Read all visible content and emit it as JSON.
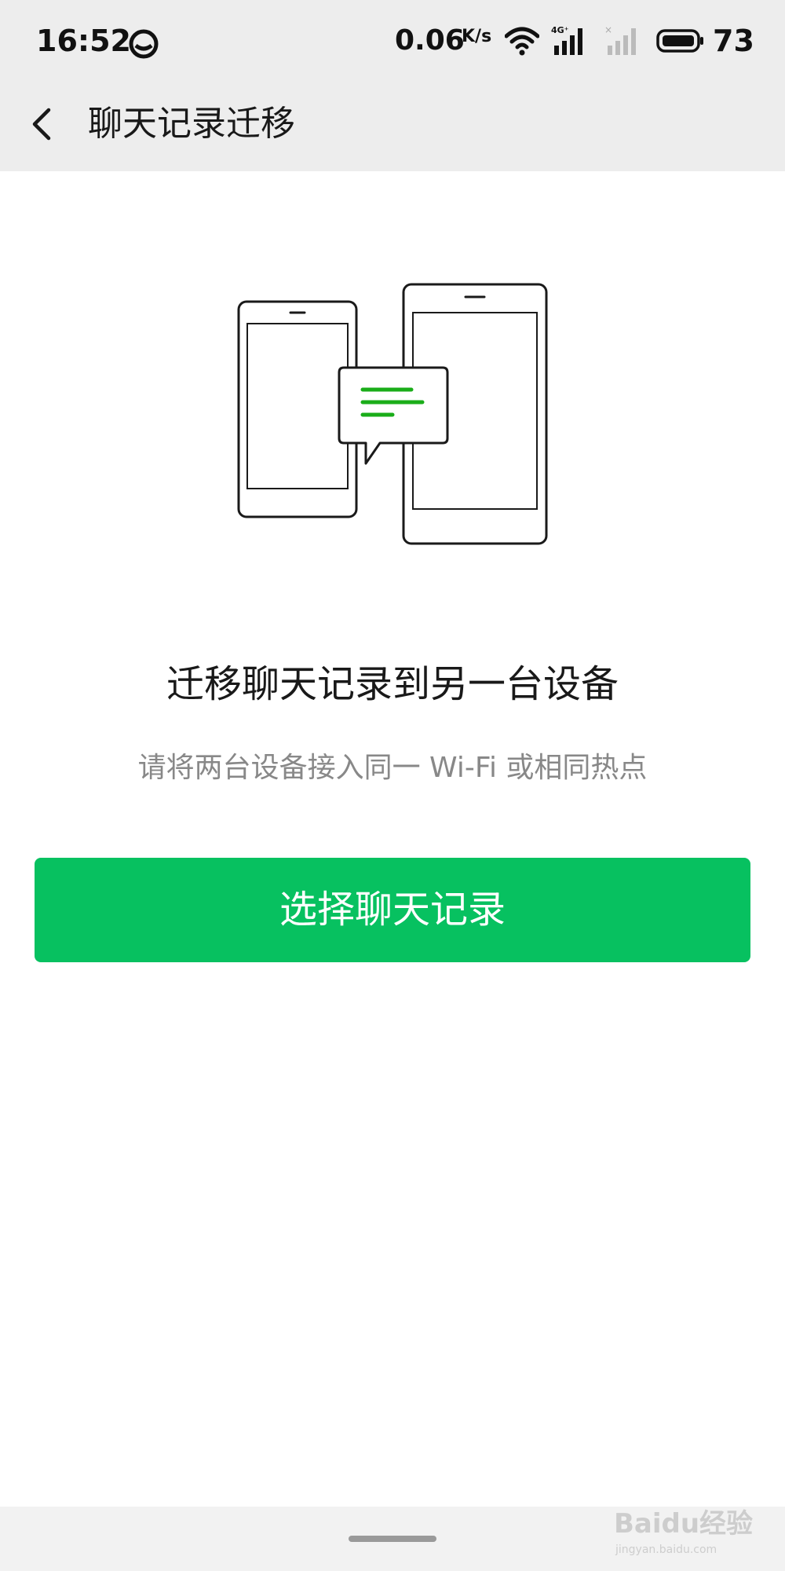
{
  "status_bar": {
    "time": "16:52",
    "speed": "0.06",
    "speed_unit": "K/s",
    "network_label": "4G⁺",
    "battery": "73"
  },
  "nav": {
    "title": "聊天记录迁移",
    "back_icon": "chevron-left-icon"
  },
  "illustration": {
    "icon": "phone-to-tablet-transfer-icon",
    "accent_color": "#1aad19"
  },
  "main": {
    "headline": "迁移聊天记录到另一台设备",
    "subline": "请将两台设备接入同一 Wi-Fi 或相同热点",
    "button_label": "选择聊天记录",
    "button_color": "#07c160"
  },
  "watermark": {
    "text": "Baidu经验",
    "subtext": "jingyan.baidu.com"
  }
}
